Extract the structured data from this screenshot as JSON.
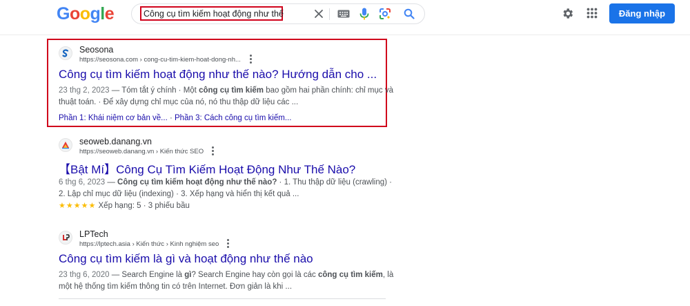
{
  "header": {
    "logo_letters": [
      "G",
      "o",
      "o",
      "g",
      "l",
      "e"
    ],
    "logo_colors": [
      "#4285f4",
      "#ea4335",
      "#fbbc05",
      "#4285f4",
      "#34a853",
      "#ea4335"
    ],
    "search_query": "Công cụ tìm kiếm hoạt động như thế nào",
    "icons": [
      "close-icon",
      "keyboard-icon",
      "microphone-icon",
      "lens-icon",
      "search-icon",
      "gear-icon",
      "apps-icon"
    ],
    "signin_label": "Đăng nhập",
    "accent_color": "#1a73e8"
  },
  "results": [
    {
      "site_name": "Seosona",
      "url": "https://seosona.com › cong-cu-tim-kiem-hoat-dong-nh...",
      "title": "Công cụ tìm kiếm hoạt động như thế nào? Hướng dẫn cho ...",
      "date": "23 thg 2, 2023",
      "snippet_line1_pre": " — Tóm tắt ý chính · Một ",
      "snippet_line1_bold": "công cụ tìm kiếm",
      "snippet_line1_post": " bao gồm hai phần chính: chỉ mục và",
      "snippet_line2": "thuật toán. · Để xây dựng chỉ mục của nó, nó thu thập dữ liệu các ...",
      "sitelink_1": "Phần 1: Khái niệm cơ bản về...",
      "sitelink_sep": " · ",
      "sitelink_2": "Phần 3: Cách công cụ tìm kiếm..."
    },
    {
      "site_name": "seoweb.danang.vn",
      "url": "https://seoweb.danang.vn › Kiến thức SEO",
      "title": "【Bật Mí】Công Cụ Tìm Kiếm Hoạt Động Như Thế Nào?",
      "date": "6 thg 6, 2023",
      "snippet_line1_pre": " — ",
      "snippet_line1_bold": "Công cụ tìm kiếm hoạt động như thế nào?",
      "snippet_line1_post": " · 1. Thu thập dữ liệu (crawling) ·",
      "snippet_line2": "2. Lập chỉ mục dữ liệu (indexing) · 3. Xếp hạng và hiển thị kết quả ...",
      "stars": "★★★★★",
      "rating_text": " Xếp hạng: 5 · 3 phiếu bầu"
    },
    {
      "site_name": "LPTech",
      "url": "https://lptech.asia › Kiến thức › Kinh nghiệm seo",
      "title": "Công cụ tìm kiếm là gì và hoạt động như thế nào",
      "date": "23 thg 6, 2020",
      "snippet_line1_pre": " — Search Engine là ",
      "snippet_line1_bold": "gì",
      "snippet_line1_mid": "? Search Engine hay còn gọi là các ",
      "snippet_line1_bold2": "công cụ tìm kiếm",
      "snippet_line1_post": ", là",
      "snippet_line2": "một hệ thống tìm kiếm thông tin có trên Internet. Đơn giản là khi ..."
    }
  ]
}
